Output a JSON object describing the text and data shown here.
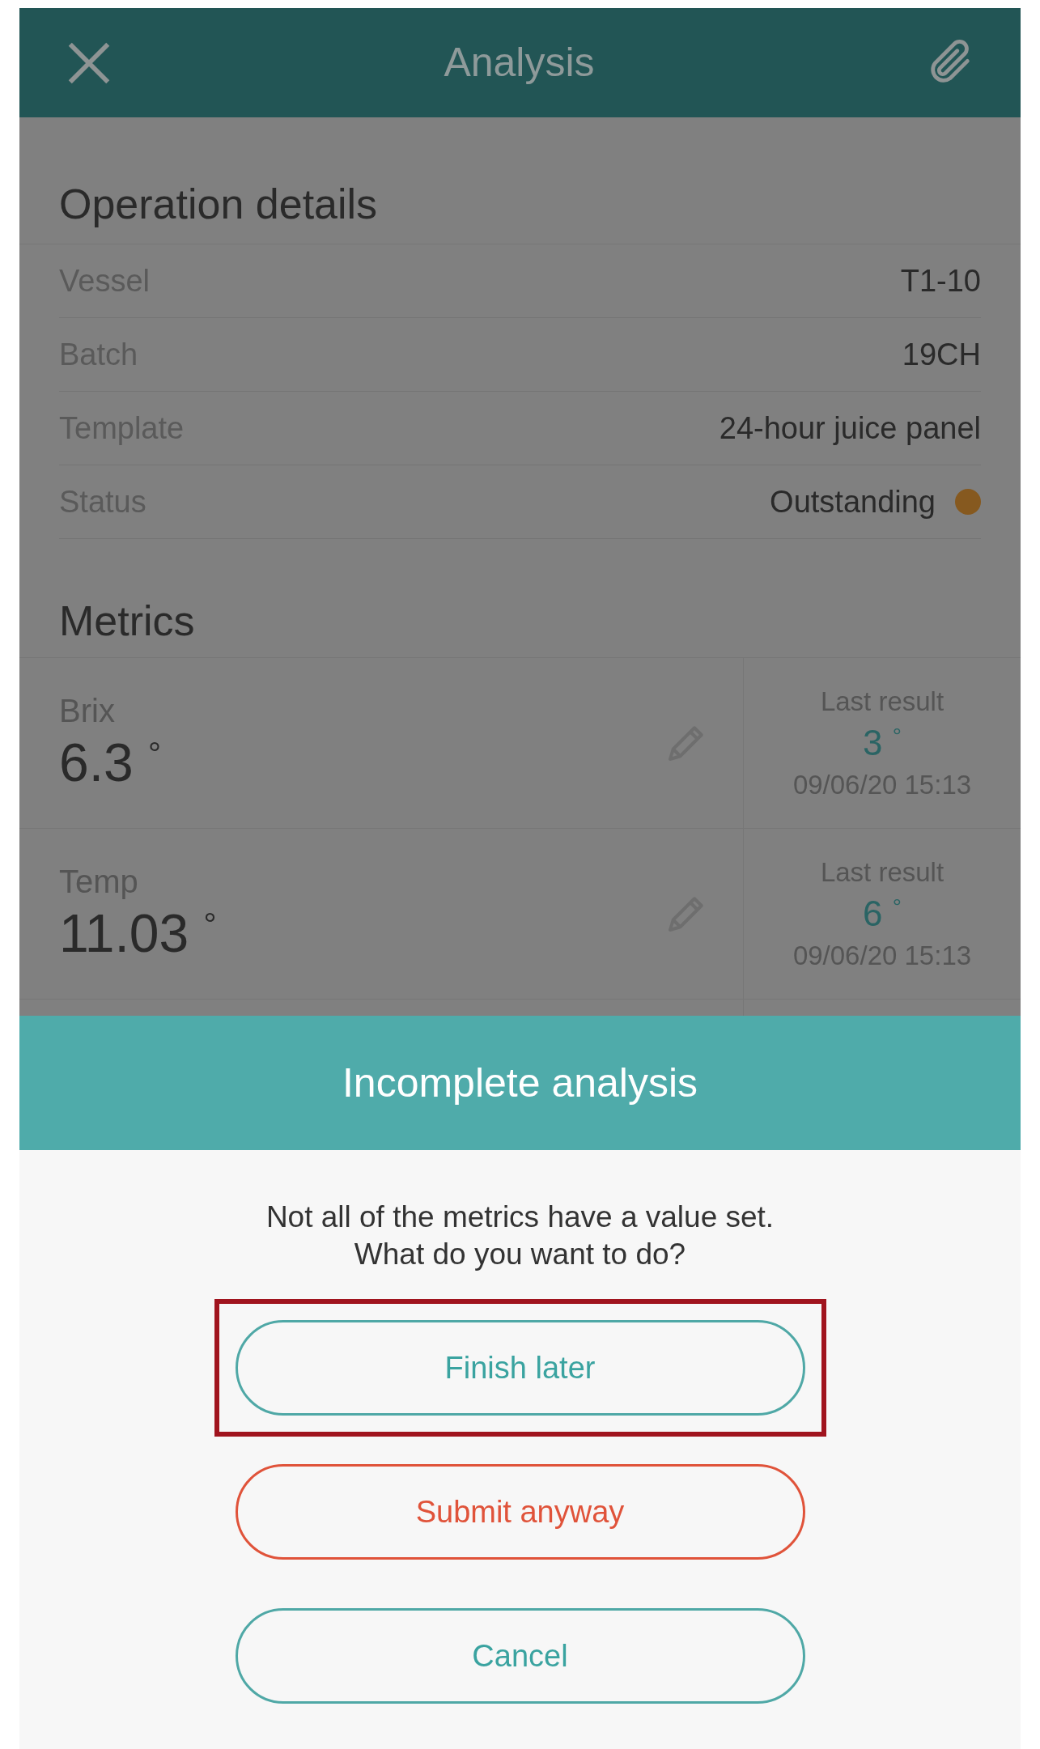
{
  "header": {
    "title": "Analysis"
  },
  "operation_details": {
    "heading": "Operation details",
    "rows": [
      {
        "label": "Vessel",
        "value": "T1-10"
      },
      {
        "label": "Batch",
        "value": "19CH"
      },
      {
        "label": "Template",
        "value": "24-hour juice panel"
      },
      {
        "label": "Status",
        "value": "Outstanding",
        "color": "#86591f"
      }
    ]
  },
  "metrics": {
    "heading": "Metrics",
    "items": [
      {
        "name": "Brix",
        "value": "6.3",
        "unit": "°",
        "last_result_label": "Last result",
        "last_value": "3",
        "last_unit": "°",
        "last_time": "09/06/20 15:13"
      },
      {
        "name": "Temp",
        "value": "11.03",
        "unit": "°",
        "last_result_label": "Last result",
        "last_value": "6",
        "last_unit": "°",
        "last_time": "09/06/20 15:13"
      }
    ]
  },
  "dialog": {
    "title": "Incomplete analysis",
    "message": "Not all of the metrics have a value set.\nWhat do you want to do?",
    "buttons": [
      {
        "label": "Finish later",
        "kind": "neutral",
        "highlighted": true
      },
      {
        "label": "Submit anyway",
        "kind": "danger",
        "highlighted": false
      },
      {
        "label": "Cancel",
        "kind": "neutral",
        "highlighted": false
      }
    ]
  }
}
